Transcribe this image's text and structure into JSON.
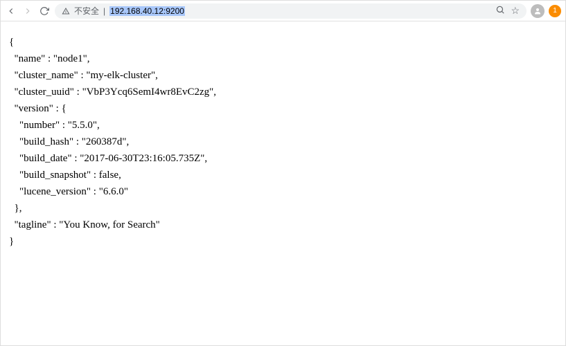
{
  "url_bar": {
    "security_label": "不安全",
    "separator": " | ",
    "address": "192.168.40.12:9200",
    "notification_count": "1"
  },
  "json": {
    "brace_open": "{",
    "l1": "  \"name\" : \"node1\",",
    "l2": "  \"cluster_name\" : \"my-elk-cluster\",",
    "l3": "  \"cluster_uuid\" : \"VbP3Ycq6SemI4wr8EvC2zg\",",
    "l4": "  \"version\" : {",
    "l5": "    \"number\" : \"5.5.0\",",
    "l6": "    \"build_hash\" : \"260387d\",",
    "l7": "    \"build_date\" : \"2017-06-30T23:16:05.735Z\",",
    "l8": "    \"build_snapshot\" : false,",
    "l9": "    \"lucene_version\" : \"6.6.0\"",
    "l10": "  },",
    "l11": "  \"tagline\" : \"You Know, for Search\"",
    "brace_close": "}"
  }
}
